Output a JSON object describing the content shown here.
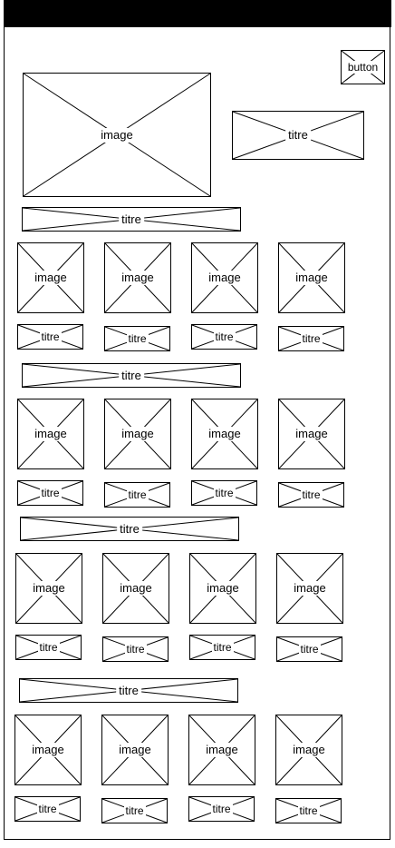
{
  "button": {
    "label": "button"
  },
  "hero": {
    "image_label": "image",
    "title_label": "titre"
  },
  "sections": [
    {
      "title": "titre",
      "items": [
        {
          "image": "image",
          "title": "titre"
        },
        {
          "image": "image",
          "title": "titre"
        },
        {
          "image": "image",
          "title": "titre"
        },
        {
          "image": "image",
          "title": "titre"
        }
      ]
    },
    {
      "title": "titre",
      "items": [
        {
          "image": "image",
          "title": "titre"
        },
        {
          "image": "image",
          "title": "titre"
        },
        {
          "image": "image",
          "title": "titre"
        },
        {
          "image": "image",
          "title": "titre"
        }
      ]
    },
    {
      "title": "titre",
      "items": [
        {
          "image": "image",
          "title": "titre"
        },
        {
          "image": "image",
          "title": "titre"
        },
        {
          "image": "image",
          "title": "titre"
        },
        {
          "image": "image",
          "title": "titre"
        }
      ]
    },
    {
      "title": "titre",
      "items": [
        {
          "image": "image",
          "title": "titre"
        },
        {
          "image": "image",
          "title": "titre"
        },
        {
          "image": "image",
          "title": "titre"
        },
        {
          "image": "image",
          "title": "titre"
        }
      ]
    }
  ]
}
